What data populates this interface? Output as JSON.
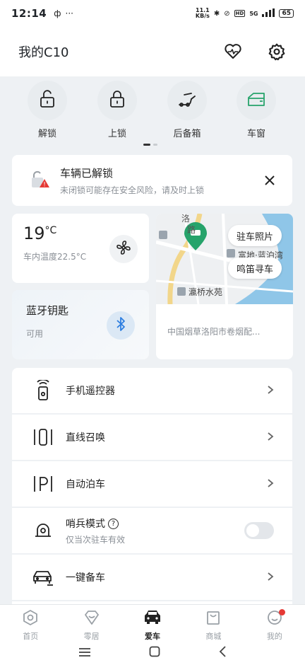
{
  "status_bar": {
    "time": "12:14",
    "net_speed_value": "11.1",
    "net_speed_unit": "KB/s",
    "battery": "65",
    "network": "5G"
  },
  "header": {
    "title": "我的C10"
  },
  "quick_controls": [
    {
      "label": "解锁",
      "icon": "unlock-icon"
    },
    {
      "label": "上锁",
      "icon": "lock-icon"
    },
    {
      "label": "后备箱",
      "icon": "trunk-icon"
    },
    {
      "label": "车窗",
      "icon": "window-icon"
    }
  ],
  "alert": {
    "title": "车辆已解锁",
    "subtitle": "未闭锁可能存在安全风险，请及时上锁"
  },
  "temperature": {
    "value": "19",
    "unit": "°C",
    "cabin": "车内温度22.5°C"
  },
  "bluetooth": {
    "title": "蓝牙钥匙",
    "status": "可用"
  },
  "map": {
    "park_photo": "驻车照片",
    "honk_find": "鸣笛寻车",
    "address": "中国烟草洛阳市卷烟配...",
    "poi_1": "瀛桥水苑",
    "poi_2": "富地·蓝泊湾",
    "road": "洛",
    "road_2": "路"
  },
  "menu": [
    {
      "label": "手机遥控器",
      "icon": "phone-remote-icon"
    },
    {
      "label": "直线召唤",
      "icon": "summon-icon"
    },
    {
      "label": "自动泊车",
      "icon": "auto-park-icon"
    },
    {
      "label": "哨兵模式",
      "sub": "仅当次驻车有效",
      "icon": "sentry-icon"
    },
    {
      "label": "一键备车",
      "icon": "car-prepare-icon"
    }
  ],
  "tabs": [
    {
      "label": "首页",
      "icon": "home-icon"
    },
    {
      "label": "零居",
      "icon": "diamond-icon"
    },
    {
      "label": "爱车",
      "icon": "car-icon"
    },
    {
      "label": "商城",
      "icon": "shop-icon"
    },
    {
      "label": "我的",
      "icon": "profile-icon"
    }
  ],
  "colors": {
    "accent_green": "#26a36b",
    "bluetooth_blue": "#2d7ee0",
    "warning_red": "#e53935"
  }
}
